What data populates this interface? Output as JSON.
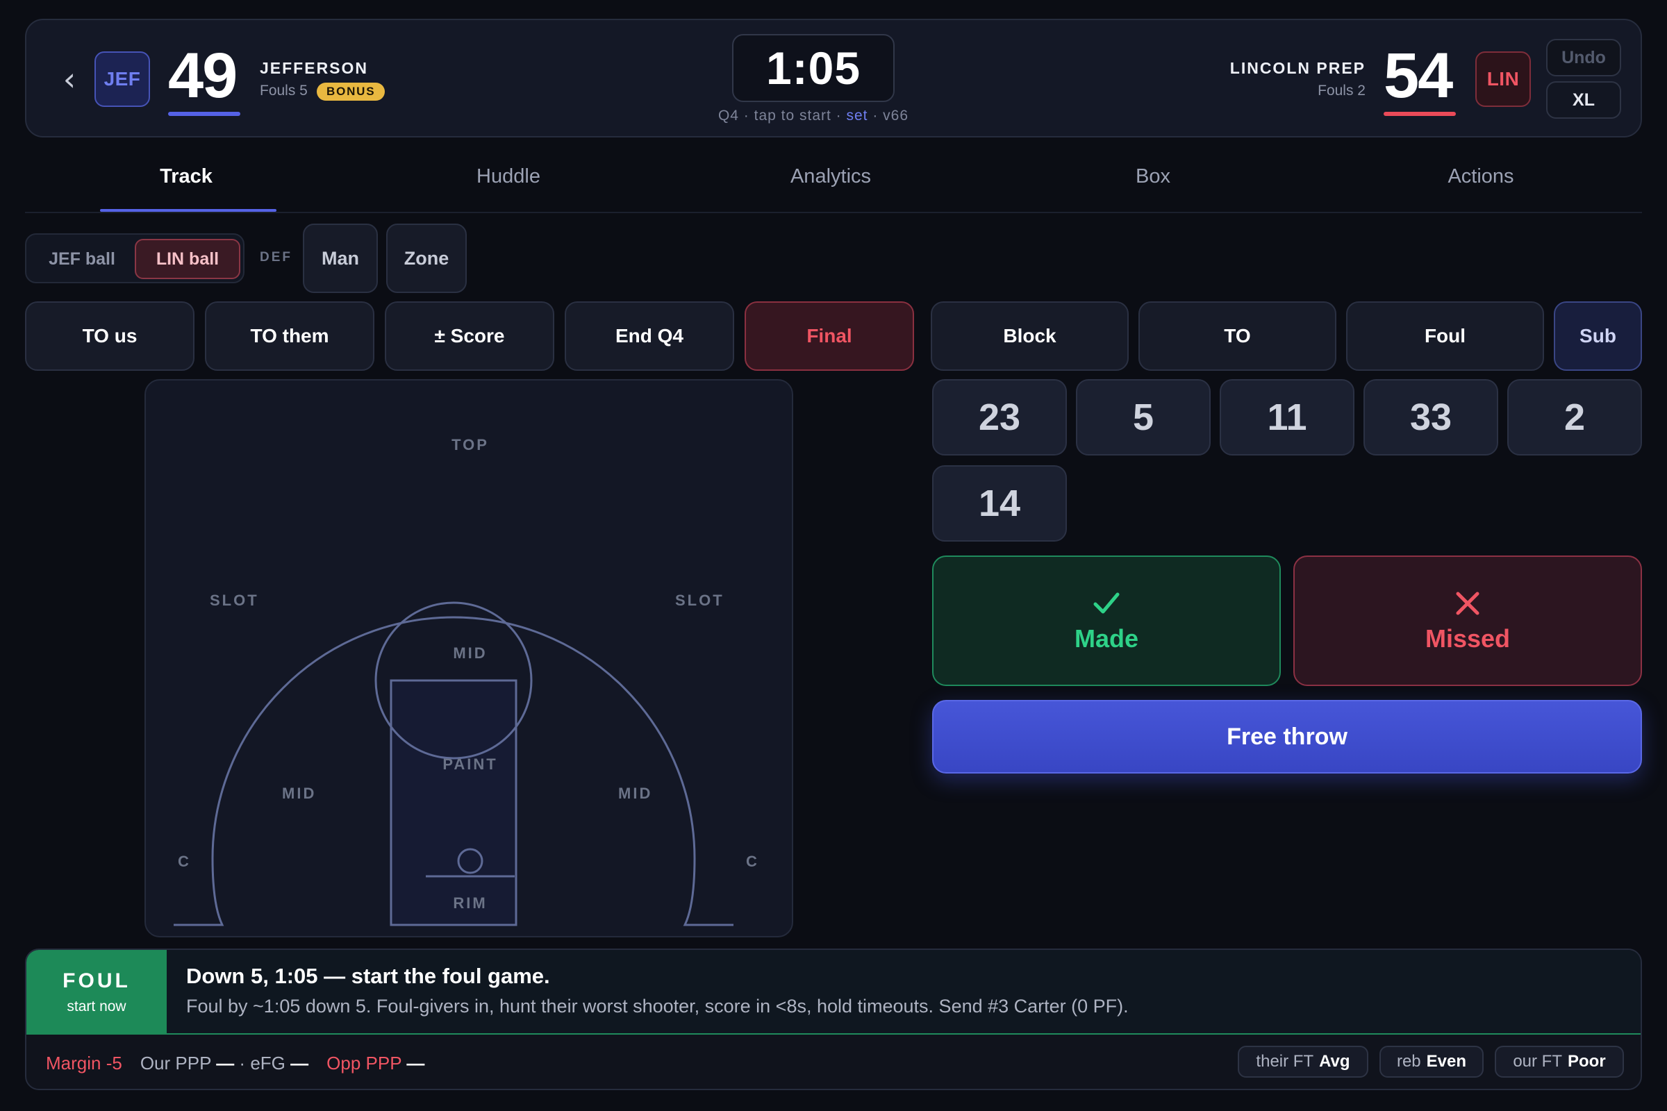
{
  "header": {
    "home": {
      "abbr": "JEF",
      "score": "49",
      "name": "JEFFERSON",
      "fouls": "Fouls 5",
      "bonus": "BONUS",
      "color": "#5562e6"
    },
    "away": {
      "abbr": "LIN",
      "score": "54",
      "name": "LINCOLN PREP",
      "fouls": "Fouls 2",
      "color": "#ea4a58"
    },
    "clock": "1:05",
    "clock_sub_pre": "Q4 · tap to start · ",
    "clock_sub_link": "set",
    "clock_sub_post": " · v66",
    "undo_label": "Undo",
    "size_label": "XL",
    "back_icon": "chevron-left-icon"
  },
  "tabs": [
    "Track",
    "Huddle",
    "Analytics",
    "Box",
    "Actions"
  ],
  "active_tab": "Track",
  "possession": {
    "home_label": "JEF ball",
    "away_label": "LIN ball",
    "selected": "LIN ball"
  },
  "defense": {
    "label": "DEF",
    "man": "Man",
    "zone": "Zone"
  },
  "game_actions": [
    "TO us",
    "TO them",
    "± Score",
    "End Q4",
    "Final"
  ],
  "stat_actions": [
    "Block",
    "TO",
    "Foul",
    "Sub"
  ],
  "court": {
    "top": "TOP",
    "slot": "SLOT",
    "mid": "MID",
    "paint": "PAINT",
    "rim": "RIM",
    "corner": "C"
  },
  "players": [
    "23",
    "5",
    "11",
    "33",
    "2",
    "14"
  ],
  "result": {
    "made": "Made",
    "missed": "Missed",
    "made_icon": "check-icon",
    "missed_icon": "x-icon",
    "made_color": "#2ed288",
    "missed_color": "#f05563"
  },
  "free_throw": "Free throw",
  "advisory": {
    "tag": "FOUL",
    "tag_sub": "start now",
    "headline": "Down 5, 1:05 — start the foul game.",
    "body": "Foul by ~1:05 down 5. Foul-givers in, hunt their worst shooter, score in <8s, hold timeouts. Send #3 Carter (0 PF)."
  },
  "stats": {
    "margin": "Margin -5",
    "our_ppp_label": "Our PPP",
    "our_ppp_value": "—",
    "efg_sep": "·",
    "efg_label": "eFG",
    "efg_value": "—",
    "opp_ppp_label": "Opp PPP",
    "opp_ppp_value": "—"
  },
  "pills": [
    {
      "label": "their FT",
      "value": "Avg"
    },
    {
      "label": "reb",
      "value": "Even"
    },
    {
      "label": "our FT",
      "value": "Poor"
    }
  ]
}
